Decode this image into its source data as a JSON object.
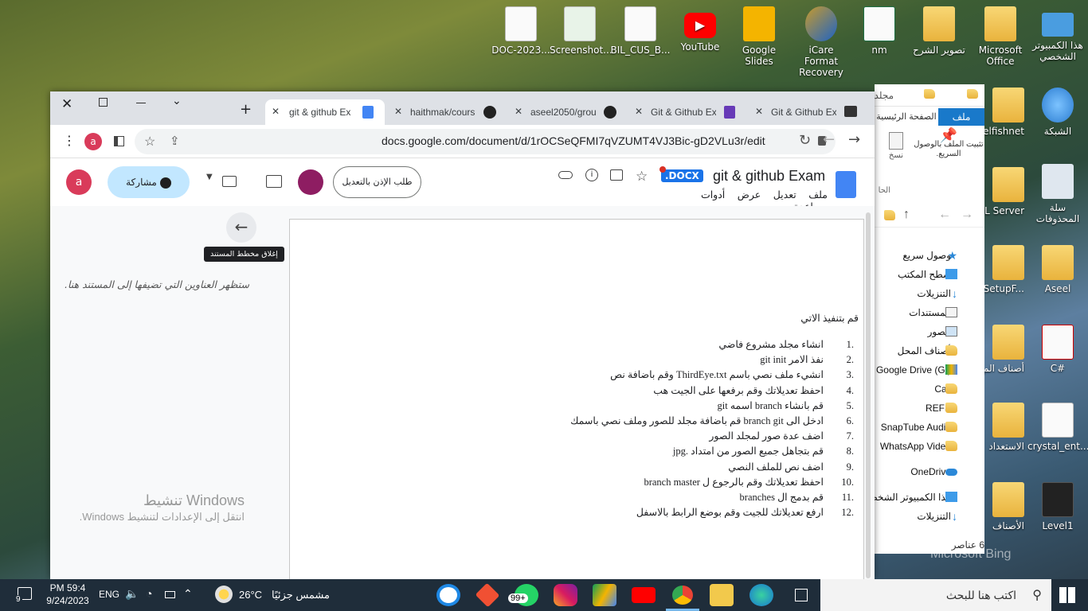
{
  "desktop": {
    "icons_top": [
      "DOC-2023...",
      "Screenshot...",
      "BIL_CUS_B...",
      "YouTube",
      "Google Slides",
      "iCare Format Recovery",
      "nm",
      "تصوير الشرح",
      "Microsoft Office",
      "هذا الكمبيوتر الشخصي"
    ],
    "icons_right": [
      "الشبكة",
      "سلة المحذوفات",
      "Aseel",
      "C#",
      "crystal_ent...",
      "Level1"
    ],
    "icons_partial": [
      "elfishnet",
      "QL Server",
      "nSetupF...",
      "أصناف الم",
      "الاستعداد",
      "الأصناف"
    ],
    "activation_title": "تنشيط Windows",
    "activation_sub": "انتقل إلى الإعدادات لتنشيط Windows.",
    "bing_mark": "Microsoft Bing"
  },
  "browser": {
    "tabs": [
      {
        "label": "git & github Ex",
        "active": true
      },
      {
        "label": "haithmak/cours",
        "active": false
      },
      {
        "label": "aseel2050/grou",
        "active": false
      },
      {
        "label": "Git & Github Ex",
        "active": false
      },
      {
        "label": "Git & Github Ex",
        "active": false
      }
    ],
    "url": "docs.google.com/document/d/1rOCSeQFMI7qVZUMT4VJ3Bic-gD2VLu3r/edit",
    "profile_letter": "a"
  },
  "docs": {
    "title": "git & github Exam",
    "badge": ".DOCX",
    "menu": [
      "ملف",
      "تعديل",
      "عرض",
      "أدوات",
      "مساعدة"
    ],
    "share_label": "مشاركة",
    "request_edit_label": "طلب الإذن بالتعديل",
    "avatar_letter": "a",
    "outline_tooltip": "إغلاق مخطط المستند",
    "outline_placeholder": "ستظهر العناوين التي تضيفها إلى المستند هنا.",
    "intro": "قم بتنفيذ الاتي",
    "steps": [
      {
        "n": "1.",
        "text": "انشاء مجلد مشروع فاضي"
      },
      {
        "n": "2.",
        "text": "نفذ الامر git init"
      },
      {
        "n": "3.",
        "text": "انشيء ملف نصي باسم ThirdEye.txt  وقم باضافة نص"
      },
      {
        "n": "4.",
        "text": "احفظ تعديلاتك وقم برفعها على الجيت هب"
      },
      {
        "n": "5.",
        "text": "قم بانشاء branch اسمه git"
      },
      {
        "n": "6.",
        "text": "ادخل الى branch git قم باضافة مجلد للصور وملف نصي باسمك"
      },
      {
        "n": "7.",
        "text": "اضف عدة صور لمجلد الصور"
      },
      {
        "n": "8.",
        "text": "قم بتجاهل جميع الصور من امتداد .jpg"
      },
      {
        "n": "9.",
        "text": "اضف نص للملف النصي"
      },
      {
        "n": "10.",
        "text": "احفظ تعديلاتك وقم بالرجوع ل branch master"
      },
      {
        "n": "11.",
        "text": "قم بدمج ال branches"
      },
      {
        "n": "12.",
        "text": "ارفع تعديلاتك للجيت وقم بوضع الرابط بالاسفل"
      }
    ]
  },
  "explorer": {
    "breadcrumb": "مجلد",
    "ribbon_tabs": [
      "ملف",
      "الصفحة الرئيسية"
    ],
    "pin_label": "تثبيت الملف بالوصول السريع.",
    "copy_label": "نسخ",
    "section_label": "الحا",
    "quick_access": "وصول سريع",
    "items": [
      "سطح المكتب",
      "التنزيلات",
      "المستندات",
      "الصور",
      "أصناف المحل",
      "Google Drive (G:)",
      "Call",
      "REFS",
      "SnapTube Audio",
      "WhatsApp Video",
      "OneDrive",
      "هذا الكمبيوتر الشخصي",
      "التنزيلات"
    ],
    "status": "6 عناصر"
  },
  "taskbar": {
    "search_placeholder": "اكتب هنا للبحث",
    "weather_temp": "26°C",
    "weather_desc": "مشمس جزئيًا",
    "lang": "ENG",
    "time": "PM 59:4",
    "date": "9/24/2023",
    "notif_count": "9",
    "whatsapp_badge": "99+"
  }
}
